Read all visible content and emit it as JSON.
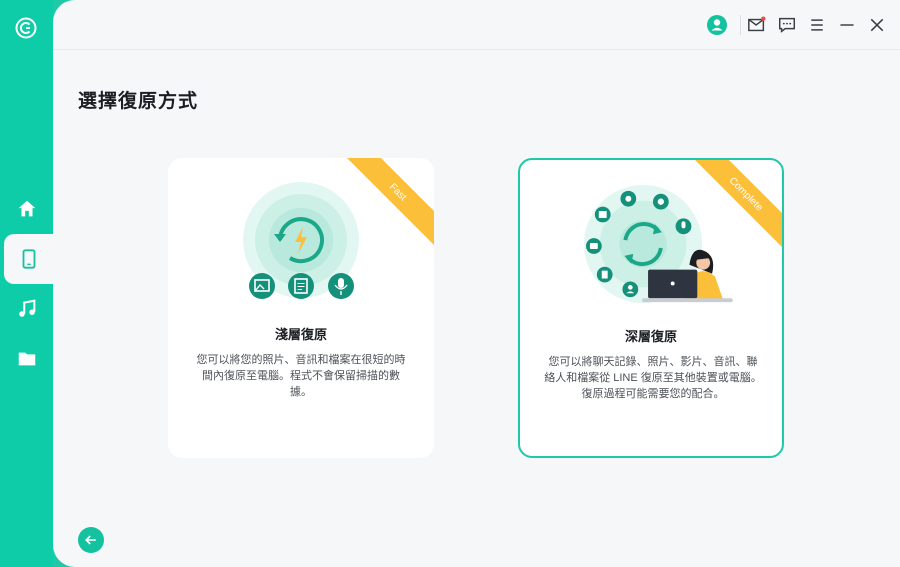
{
  "app": {
    "title": "選擇復原方式"
  },
  "sidebar": {
    "items": [
      {
        "name": "home",
        "icon": "home-icon",
        "active": false
      },
      {
        "name": "device",
        "icon": "phone-icon",
        "active": true
      },
      {
        "name": "music",
        "icon": "music-icon",
        "active": false
      },
      {
        "name": "files",
        "icon": "folder-icon",
        "active": false
      }
    ]
  },
  "topbar": {
    "icons": [
      "user-icon",
      "mail-icon",
      "chat-icon",
      "menu-icon",
      "minimize-icon",
      "close-icon"
    ]
  },
  "cards": [
    {
      "badge": "Fast",
      "title": "淺層復原",
      "description": "您可以將您的照片、音訊和檔案在很短的時間內復原至電腦。程式不會保留掃描的數據。",
      "selected": false
    },
    {
      "badge": "Complete",
      "title": "深層復原",
      "description": "您可以將聊天記錄、照片、影片、音訊、聯絡人和檔案從 LINE 復原至其他裝置或電腦。 復原過程可能需要您的配合。",
      "selected": true
    }
  ],
  "colors": {
    "accent": "#1fc9a8",
    "ribbon": "#fbbf3a",
    "background": "#f6f7f9"
  }
}
